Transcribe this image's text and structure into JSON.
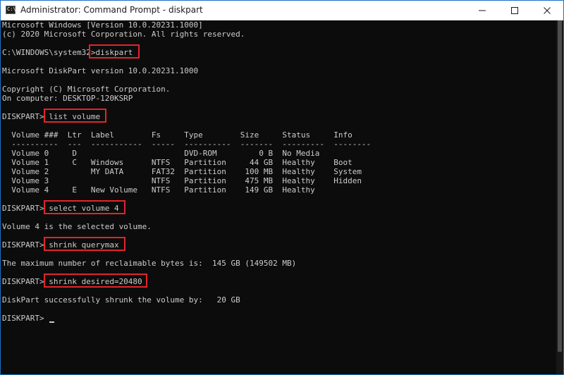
{
  "window": {
    "title": "Administrator: Command Prompt - diskpart",
    "icon_text": "C:\\",
    "controls": [
      "minimize-icon",
      "maximize-icon",
      "close-icon"
    ]
  },
  "colors": {
    "console_bg": "#0c0c0c",
    "console_text": "#cccccc",
    "highlight": "#e3242b",
    "window_border": "#1c6fc1"
  },
  "console": {
    "lines": [
      "Microsoft Windows [Version 10.0.20231.1000]",
      "(c) 2020 Microsoft Corporation. All rights reserved.",
      "",
      "C:\\WINDOWS\\system32>diskpart",
      "",
      "Microsoft DiskPart version 10.0.20231.1000",
      "",
      "Copyright (C) Microsoft Corporation.",
      "On computer: DESKTOP-120KSRP",
      "",
      "DISKPART> list volume",
      "",
      "  Volume ###  Ltr  Label        Fs     Type        Size     Status     Info",
      "  ----------  ---  -----------  -----  ----------  -------  ---------  --------",
      "  Volume 0     D                       DVD-ROM         0 B  No Media",
      "  Volume 1     C   Windows      NTFS   Partition     44 GB  Healthy    Boot",
      "  Volume 2         MY DATA      FAT32  Partition    100 MB  Healthy    System",
      "  Volume 3                      NTFS   Partition    475 MB  Healthy    Hidden",
      "  Volume 4     E   New Volume   NTFS   Partition    149 GB  Healthy",
      "",
      "DISKPART> select volume 4",
      "",
      "Volume 4 is the selected volume.",
      "",
      "DISKPART> shrink querymax",
      "",
      "The maximum number of reclaimable bytes is:  145 GB (149502 MB)",
      "",
      "DISKPART> shrink desired=20480",
      "",
      "DiskPart successfully shrunk the volume by:   20 GB",
      "",
      "DISKPART> "
    ]
  }
}
